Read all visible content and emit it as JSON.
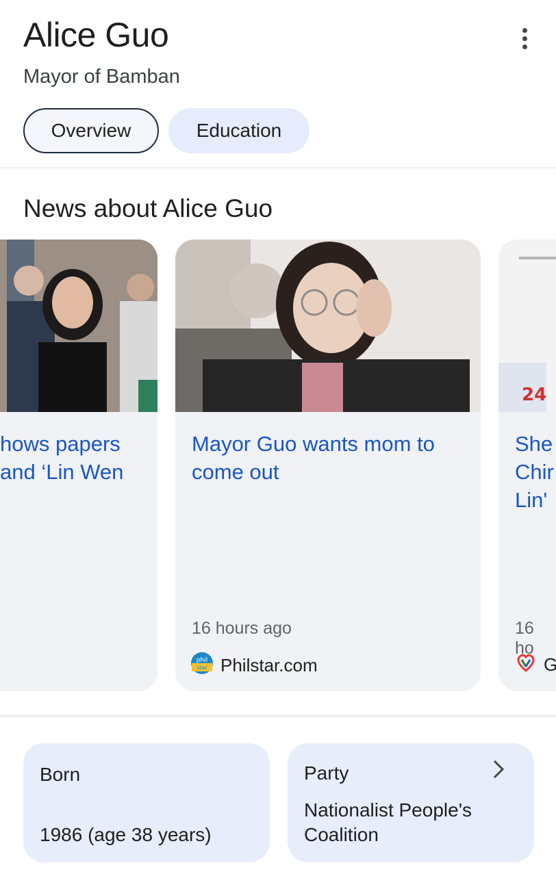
{
  "header": {
    "title": "Alice Guo",
    "subtitle": "Mayor of Bamban",
    "more_icon": "more-vert-icon"
  },
  "tabs": [
    {
      "label": "Overview",
      "selected": true
    },
    {
      "label": "Education",
      "selected": false
    }
  ],
  "news": {
    "section_title": "News about Alice Guo",
    "cards": [
      {
        "title_line1": "hows papers",
        "title_line2": "and ‘Lin Wen",
        "time": "",
        "source": ""
      },
      {
        "title_line1": "Mayor Guo wants mom to",
        "title_line2": "come out",
        "time": "16 hours ago",
        "source": "Philstar.com",
        "source_icon": "philstar-logo"
      },
      {
        "title_line1": "She",
        "title_line2": "Chir",
        "title_line3": "Lin'",
        "time": "16 ho",
        "source": "G",
        "source_icon": "gma-heart-logo"
      }
    ]
  },
  "facts": [
    {
      "label": "Born",
      "value": "1986 (age 38 years)"
    },
    {
      "label": "Party",
      "value_line1": "Nationalist People's",
      "value_line2": "Coalition",
      "chevron_icon": "chevron-right-icon"
    }
  ],
  "colors": {
    "link": "#1a56c4",
    "chip_bg": "#e6ecfb",
    "card_bg": "#f0f2f5"
  }
}
